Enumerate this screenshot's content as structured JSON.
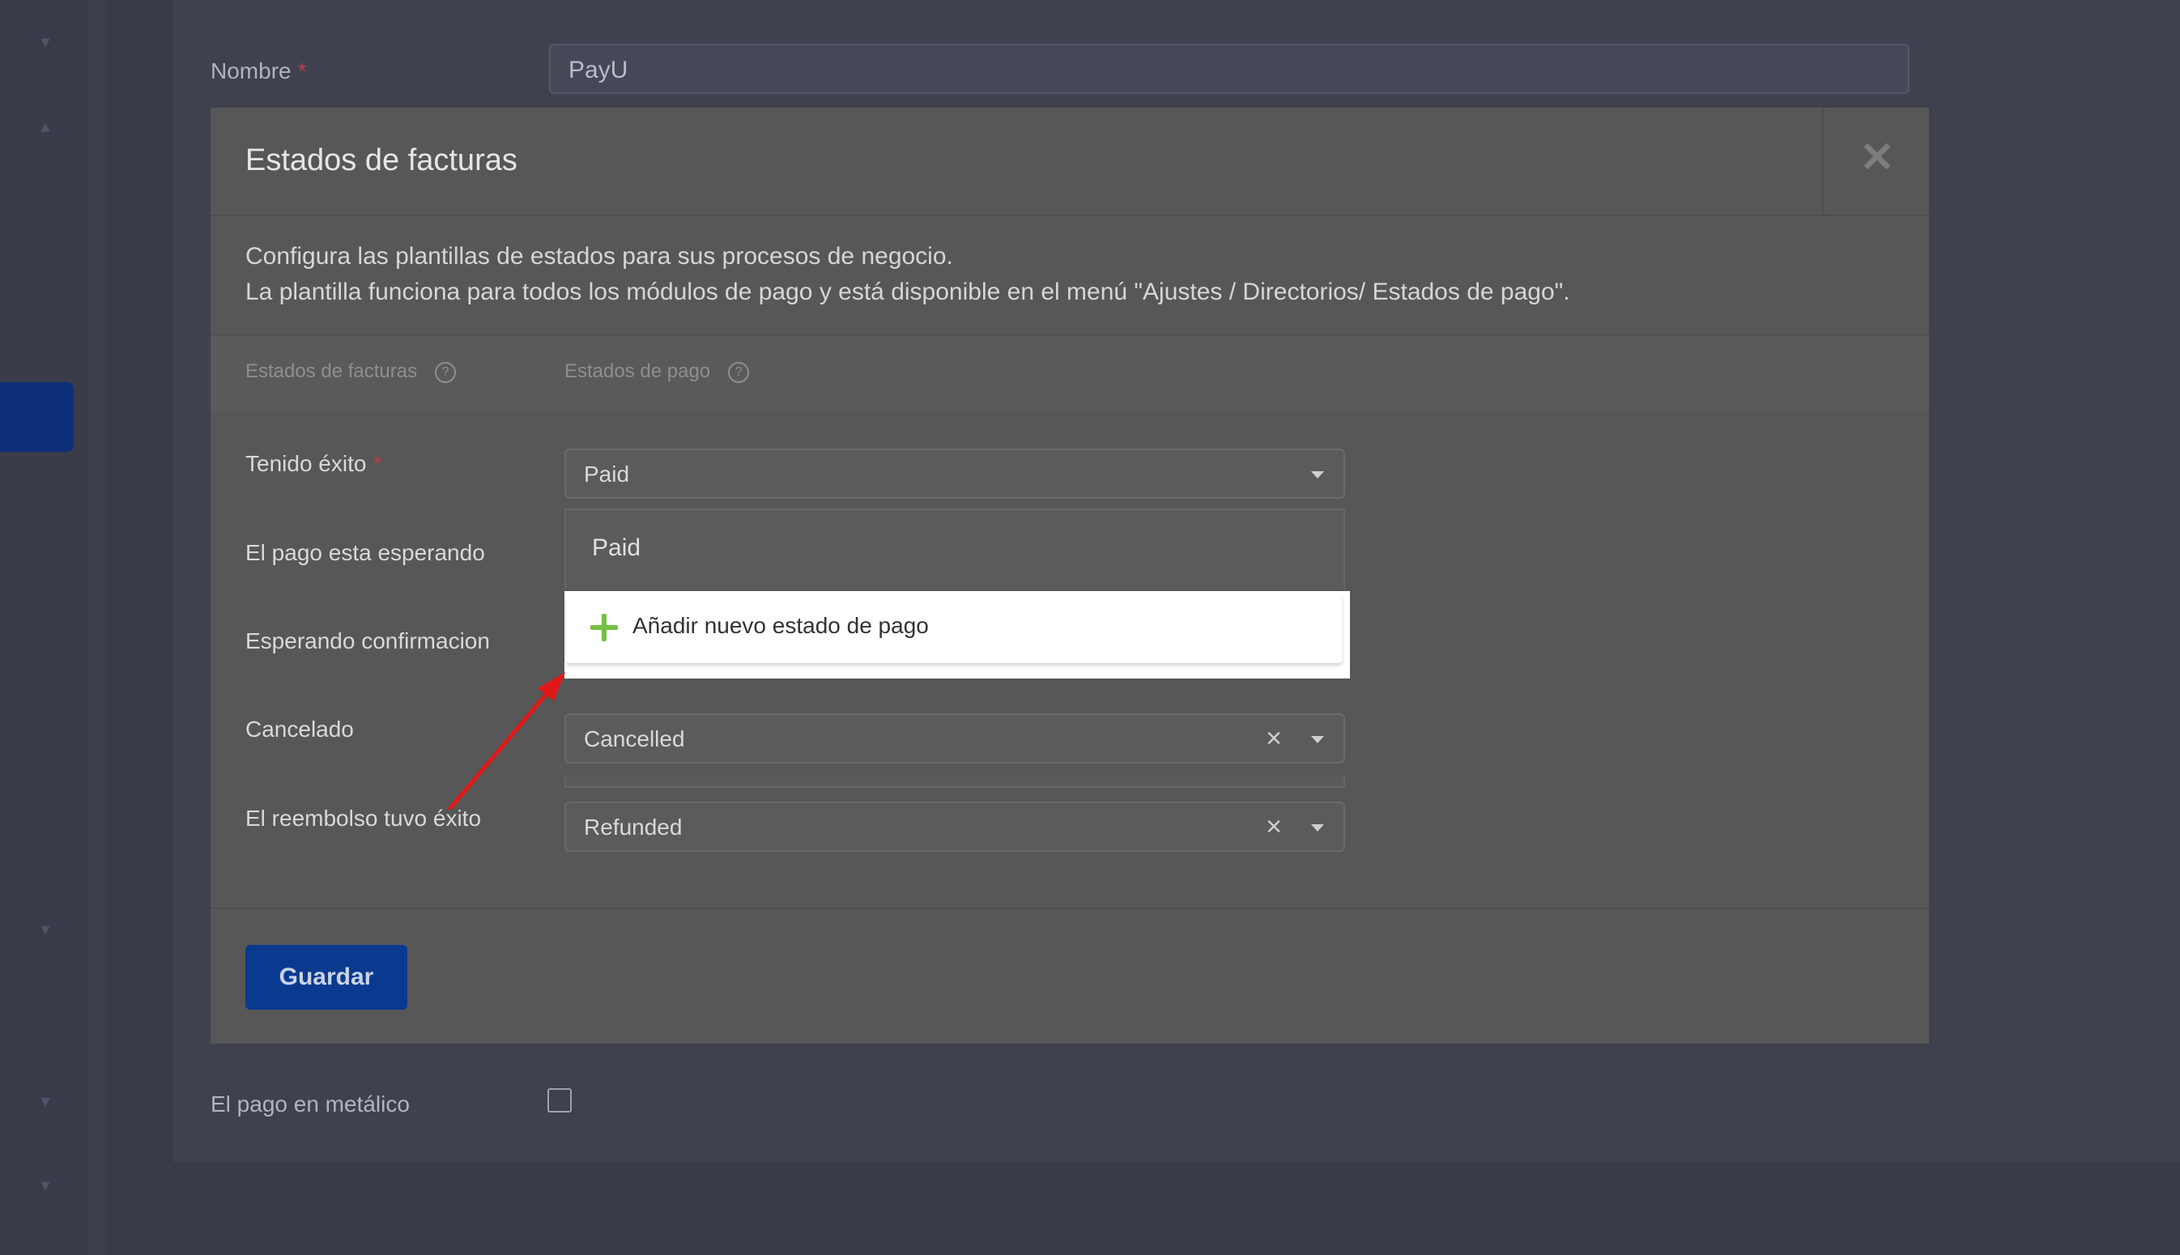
{
  "form": {
    "name_label": "Nombre",
    "required_mark": "*",
    "name_value": "PayU",
    "cash_label": "El pago en metálico"
  },
  "modal": {
    "title": "Estados de facturas",
    "close_symbol": "✕",
    "description_line1": "Configura las plantillas de estados para sus procesos de negocio.",
    "description_line2": "La plantilla funciona para todos los módulos de pago y está disponible en el menú \"Ajustes / Directorios/ Estados de pago\".",
    "col_invoice_states": "Estados de facturas",
    "col_payment_states": "Estados de pago",
    "help_symbol": "?",
    "rows": [
      {
        "label": "Tenido éxito",
        "required": true,
        "value": "Paid"
      },
      {
        "label": "El pago esta esperando",
        "required": false,
        "value": ""
      },
      {
        "label": "Esperando confirmacion",
        "required": false,
        "value": ""
      },
      {
        "label": "Cancelado",
        "required": false,
        "value": "Cancelled"
      },
      {
        "label": "El reembolso tuvo éxito",
        "required": false,
        "value": "Refunded"
      }
    ],
    "clear_symbol": "×",
    "dropdown": {
      "options": [
        "Paid"
      ],
      "add_new_label": "Añadir nuevo estado de pago"
    },
    "save_label": "Guardar"
  },
  "colors": {
    "accent_green": "#75c043",
    "save_blue": "#0a3a90",
    "annotation_red": "#e01818"
  }
}
